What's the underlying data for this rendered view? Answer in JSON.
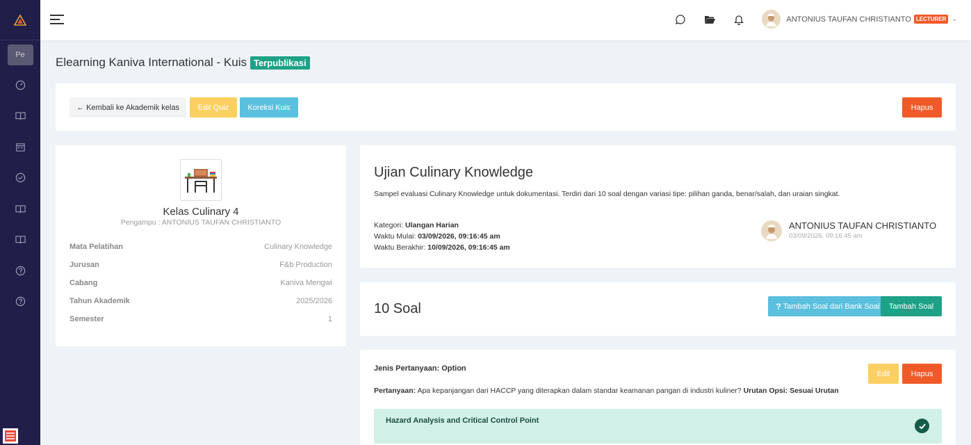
{
  "sidebar": {
    "pe_label": "Pe",
    "icons": [
      "gauge-icon",
      "book-icon",
      "calendar-icon",
      "check-circle-icon",
      "book-icon",
      "book-icon",
      "help-circle-icon",
      "help-circle-icon"
    ]
  },
  "topbar": {
    "user_name": "ANTONIUS TAUFAN CHRISTIANTO",
    "role_badge": "LECTURER"
  },
  "page": {
    "title": "Elearning Kaniva International - Kuis",
    "status_badge": "Terpublikasi"
  },
  "actions": {
    "back_label": "← Kembali ke Akademik kelas",
    "edit_label": "Edit Quiz",
    "koreksi_label": "Koreksi Kuis",
    "hapus_label": "Hapus"
  },
  "class_info": {
    "name": "Kelas Culinary 4",
    "pengampu": "Pengampu : ANTONIUS TAUFAN CHRISTIANTO",
    "rows": [
      {
        "label": "Mata Pelatihan",
        "value": "Culinary Knowledge"
      },
      {
        "label": "Jurusan",
        "value": "F&b Production"
      },
      {
        "label": "Cabang",
        "value": "Kaniva Mengwi"
      },
      {
        "label": "Tahun Akademik",
        "value": "2025/2026"
      },
      {
        "label": "Semester",
        "value": "1"
      }
    ]
  },
  "quiz": {
    "title": "Ujian Culinary Knowledge",
    "description": "Sampel evaluasi Culinary Knowledge untuk dokumentasi. Terdiri dari 10 soal dengan variasi tipe: pilihan ganda, benar/salah, dan uraian singkat.",
    "kategori_label": "Kategori:",
    "kategori_value": "Ulangan Harian",
    "mulai_label": "Waktu Mulai:",
    "mulai_value": "03/09/2026, 09:16:45 am",
    "berakhir_label": "Waktu Berakhir:",
    "berakhir_value": "10/09/2026, 09:16:45 am",
    "author_name": "ANTONIUS TAUFAN CHRISTIANTO",
    "author_date": "03/09/2026, 09:16:45 am"
  },
  "soal": {
    "count_label": "10 Soal",
    "bank_label": "Tambah Soal dari Bank Soal",
    "bank_icon_glyph": "?",
    "tambah_label": "Tambah Soal"
  },
  "question": {
    "type_label": "Jenis Pertanyaan: Option",
    "prefix": "Pertanyaan:",
    "text": "Apa kepanjangan dari HACCP yang diterapkan dalam standar keamanan pangan di industri kuliner?",
    "order_label": "Urutan Opsi: Sesuai Urutan",
    "edit_label": "Edit",
    "hapus_label": "Hapus",
    "answer": "Hazard Analysis and Critical Control Point"
  },
  "colors": {
    "sidebar_bg": "#211f4a",
    "success": "#1fa187",
    "info": "#5bc0de",
    "warning": "#fbcf62",
    "danger": "#f05a28"
  }
}
